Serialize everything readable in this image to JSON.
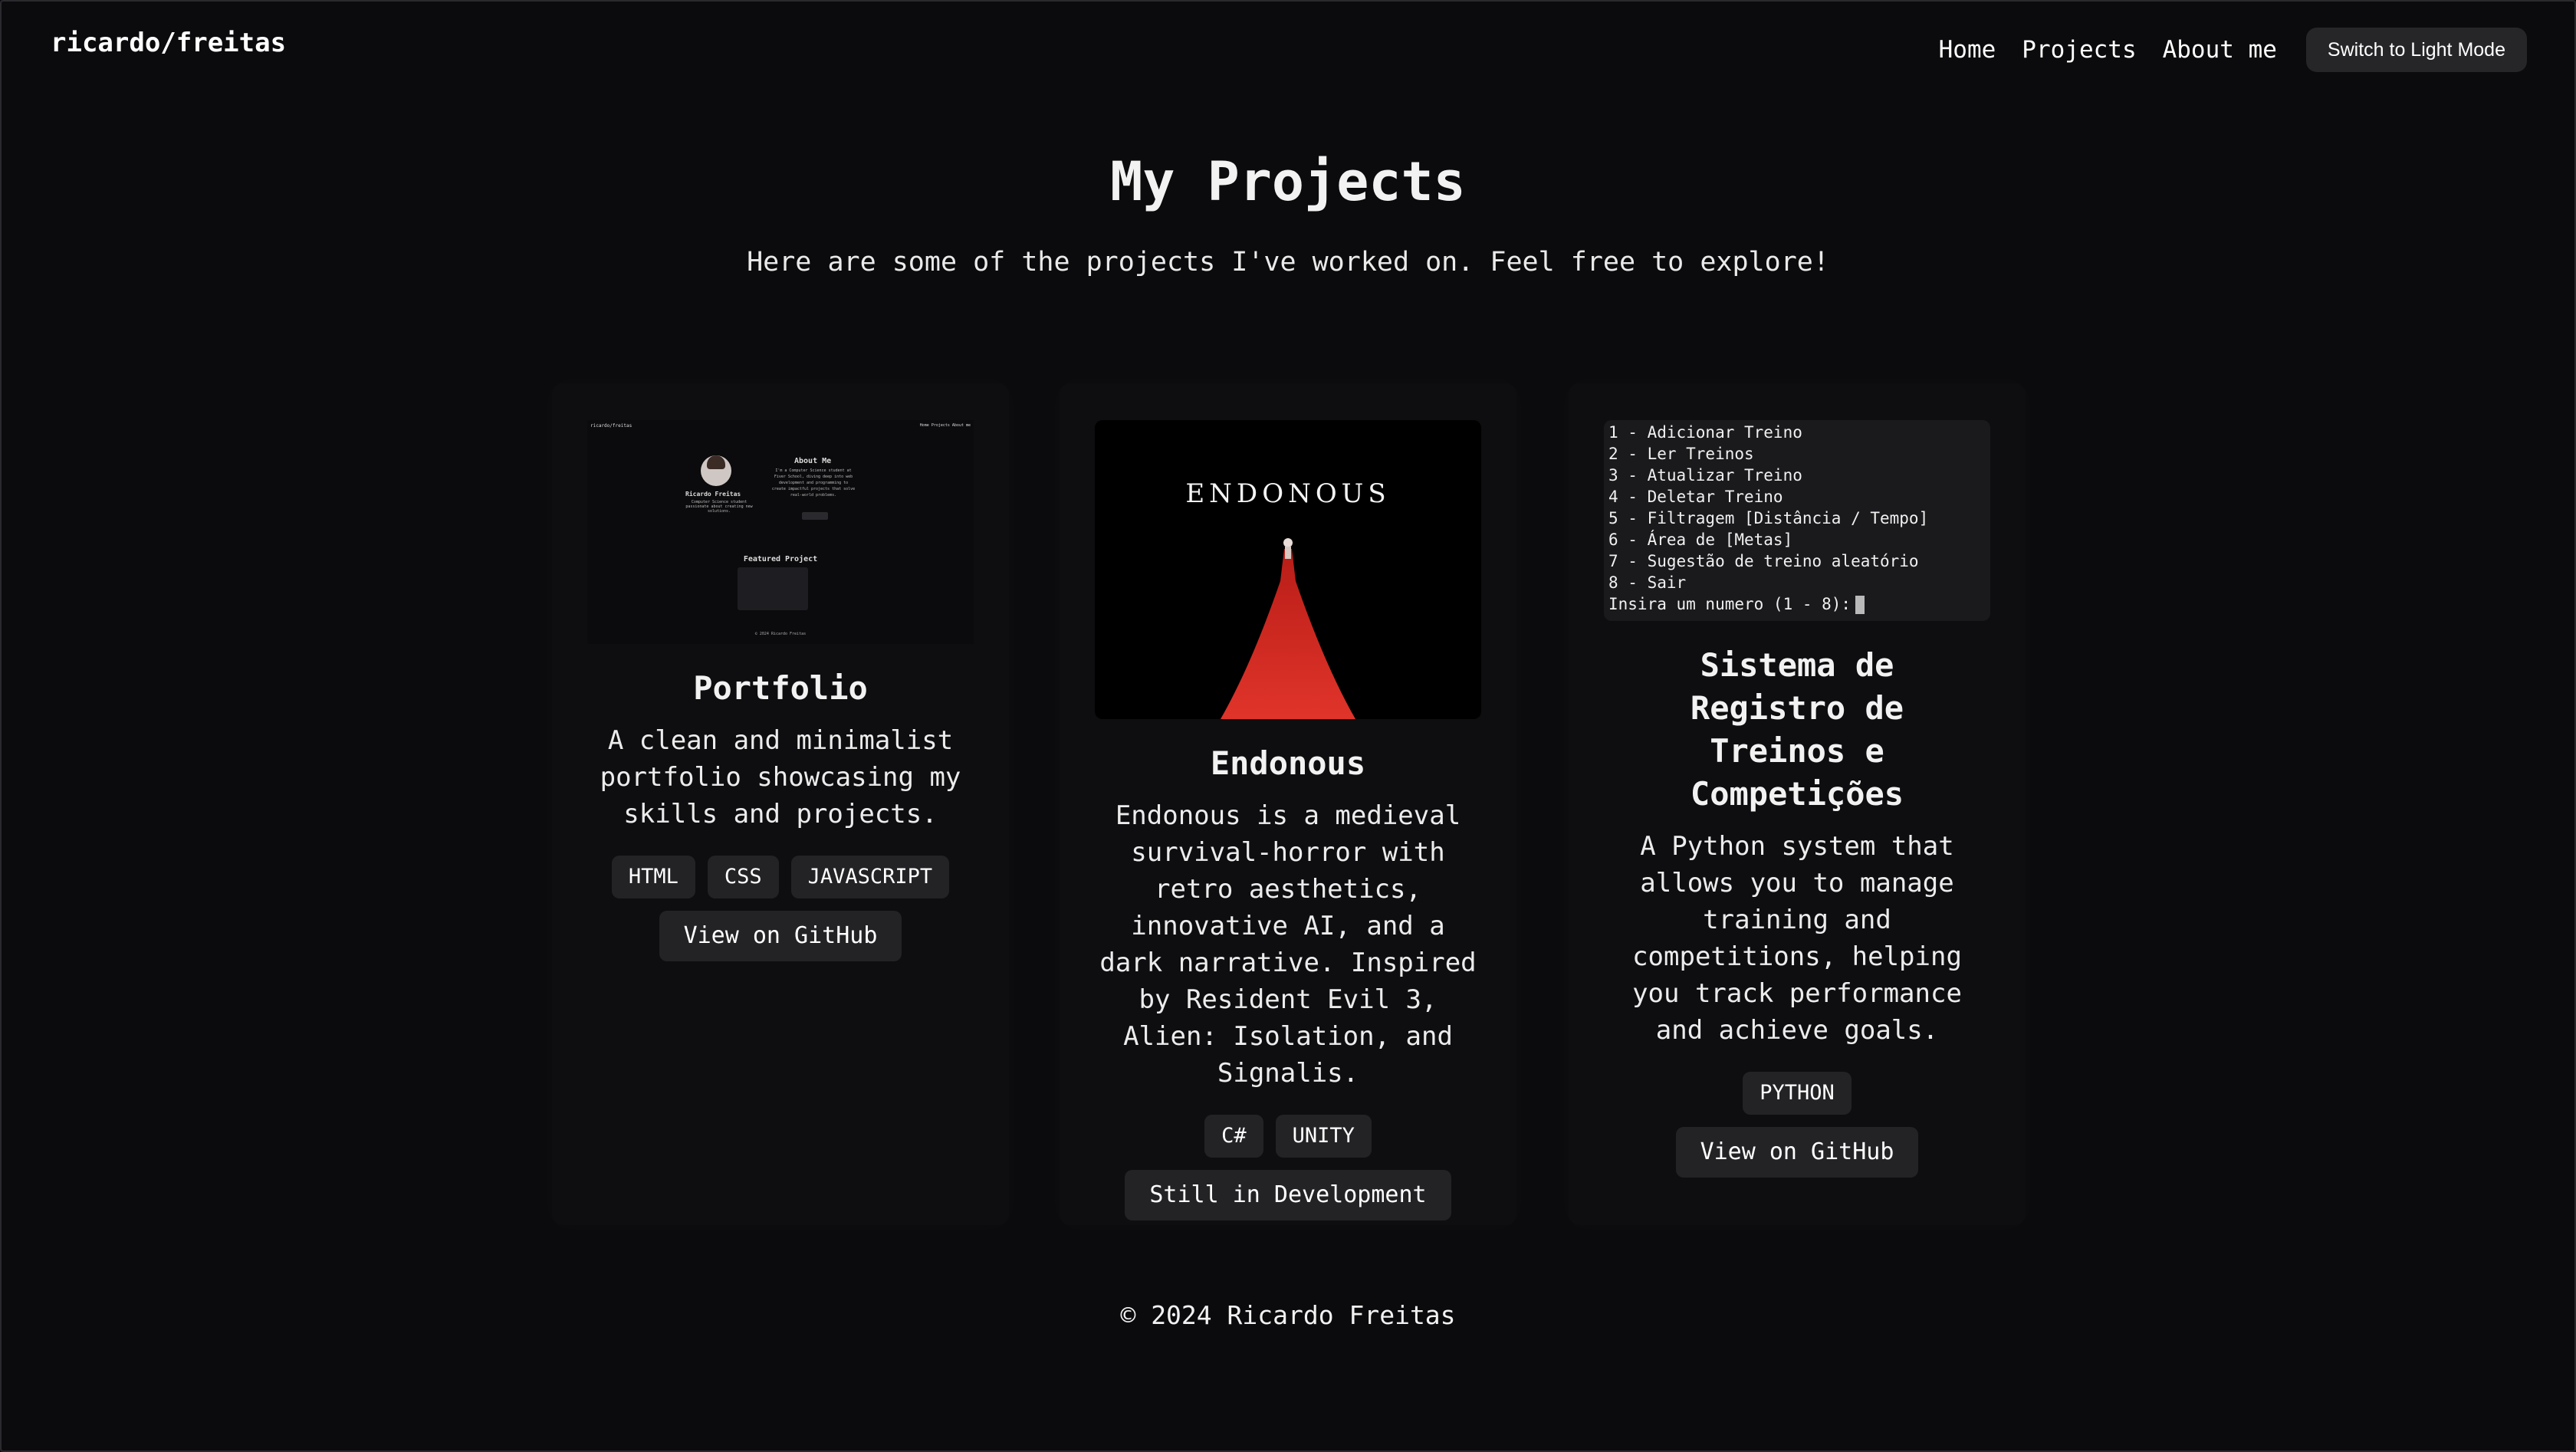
{
  "header": {
    "logo": "ricardo/freitas",
    "nav": [
      "Home",
      "Projects",
      "About me"
    ],
    "theme_button": "Switch to Light Mode"
  },
  "hero": {
    "title": "My Projects",
    "subtitle": "Here are some of the projects I've worked on. Feel free to explore!"
  },
  "projects": [
    {
      "title": "Portfolio",
      "description": "A clean and minimalist portfolio showcasing my skills and projects.",
      "tags": [
        "HTML",
        "CSS",
        "JAVASCRIPT"
      ],
      "button": "View on GitHub",
      "thumbnail": {
        "logo": "ricardo/freitas",
        "nav": "Home  Projects  About me",
        "name": "Ricardo Freitas",
        "name_sub": "Computer Science student passionate about creating new solutions.",
        "about_title": "About Me",
        "about_text": "I'm a Computer Science student at Fiver School, diving deep into web development and programming to create impactful projects that solve real-world problems.",
        "featured_title": "Featured Project",
        "footer": "© 2024 Ricardo Freitas"
      }
    },
    {
      "title": "Endonous",
      "description": "Endonous is a medieval survival-horror with retro aesthetics, innovative AI, and a dark narrative. Inspired by Resident Evil 3, Alien: Isolation, and Signalis.",
      "tags": [
        "C#",
        "UNITY"
      ],
      "button": "Still in Development",
      "thumbnail": {
        "title": "ENDONOUS"
      }
    },
    {
      "title": "Sistema de Registro de Treinos e Competições",
      "description": "A Python system that allows you to manage training and competitions, helping you track performance and achieve goals.",
      "tags": [
        "PYTHON"
      ],
      "button": "View on GitHub",
      "thumbnail": {
        "lines": [
          "1 - Adicionar Treino",
          "2 - Ler Treinos",
          "3 - Atualizar Treino",
          "4 - Deletar Treino",
          "5 - Filtragem [Distância / Tempo]",
          "6 - Área de [Metas]",
          "7 - Sugestão de treino aleatório",
          "8 - Sair",
          "Insira um numero (1 - 8):"
        ]
      }
    }
  ],
  "footer": "© 2024 Ricardo Freitas"
}
